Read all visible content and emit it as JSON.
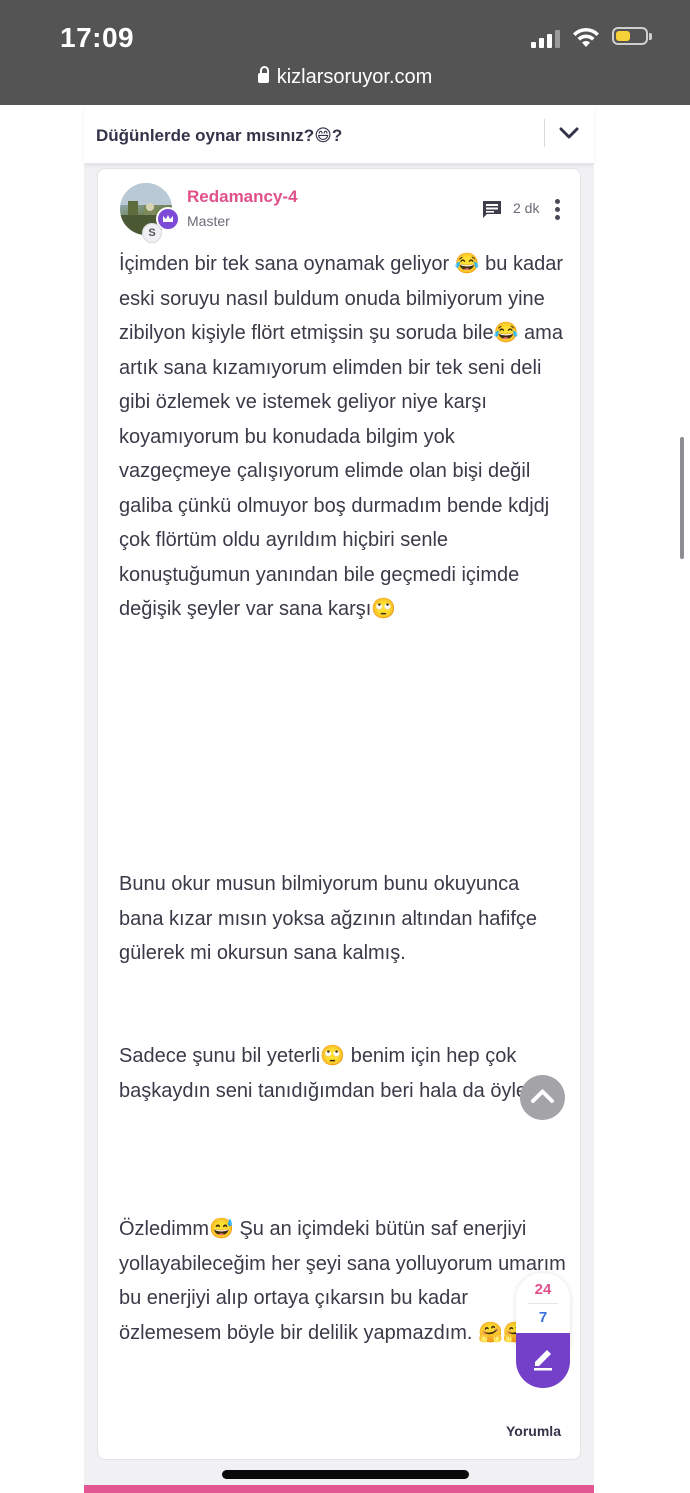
{
  "status_bar": {
    "time": "17:09"
  },
  "browser": {
    "url": "kizlarsoruyor.com"
  },
  "question": {
    "title": "Düğünlerde oynar mısınız?😄?"
  },
  "answer": {
    "username": "Redamancy-4",
    "rank": "Master",
    "badge_letter": "S",
    "time_ago": "2 dk",
    "paragraphs": [
      "İçimden bir tek sana oynamak geliyor 😂 bu kadar eski soruyu nasıl buldum onuda bilmiyorum yine zibilyon kişiyle flört etmişsin şu soruda bile😂 ama artık sana kızamıyorum elimden bir tek seni deli gibi özlemek ve istemek geliyor niye karşı koyamıyorum bu konudada bilgim yok vazgeçmeye çalışıyorum elimde olan bişi değil galiba çünkü olmuyor boş durmadım bende kdjdj çok flörtüm oldu ayrıldım hiçbiri senle konuştuğumun yanından bile geçmedi içimde değişik şeyler var sana karşı🙄",
      "Bunu okur musun bilmiyorum bunu okuyunca bana kızar mısın yoksa ağzının altından hafifçe gülerek mi okursun sana kalmış.",
      "Sadece şunu bil yeterli🙄 benim için hep çok başkaydın seni tanıdığımdan beri hala da öylesin",
      "Özledimm😅 Şu an içimdeki bütün saf enerjiyi yollayabileceğim her şeyi sana yolluyorum umarım bu enerjiyi alıp ortaya çıkarsın bu kadar özlemesem böyle bir delilik yapmazdım. 🤗🤗"
    ],
    "reply_label": "Yorumla"
  },
  "votes": {
    "up": "24",
    "down": "7"
  }
}
